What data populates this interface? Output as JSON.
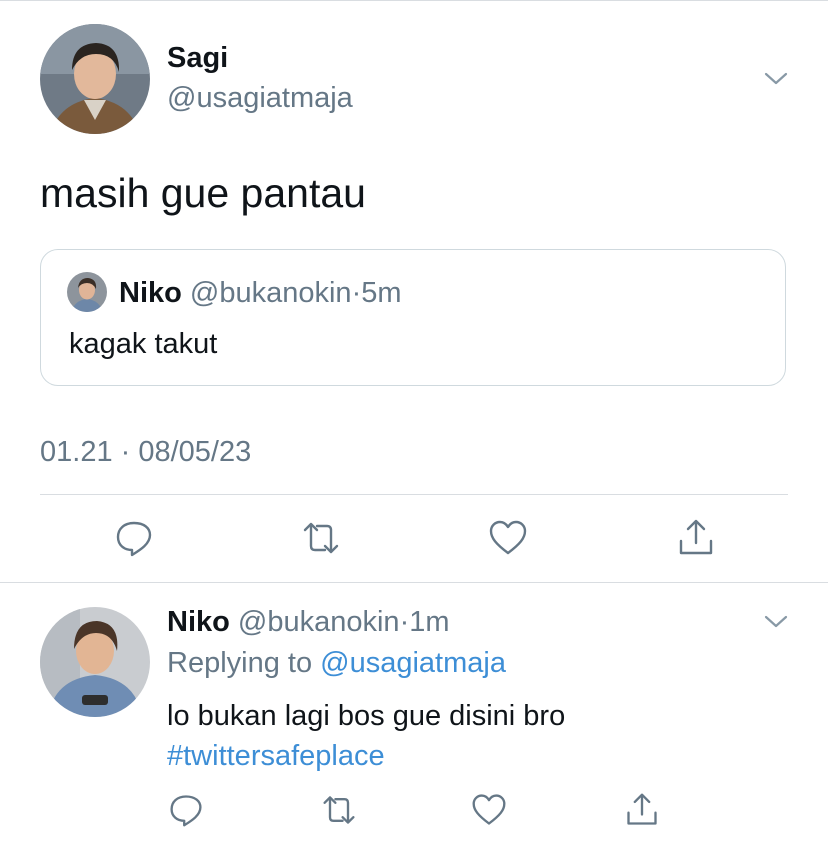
{
  "main_tweet": {
    "author_name": "Sagi",
    "author_handle": "@usagiatmaja",
    "text": "masih gue pantau",
    "timestamp": "01.21 · 08/05/23",
    "quoted": {
      "author_name": "Niko",
      "author_handle": "@bukanokin",
      "separator": "·",
      "time": "5m",
      "text": "kagak takut"
    }
  },
  "reply_tweet": {
    "author_name": "Niko",
    "author_handle": "@bukanokin",
    "separator": "·",
    "time": "1m",
    "replying_prefix": "Replying to",
    "replying_handle": "@usagiatmaja",
    "text": "lo bukan lagi bos gue disini bro",
    "hashtag": "#twittersafeplace"
  },
  "icons": {
    "reply": "reply-icon",
    "retweet": "retweet-icon",
    "like": "heart-icon",
    "share": "share-icon",
    "menu": "chevron-down-icon"
  },
  "colors": {
    "text": "#0f1419",
    "secondary": "#657786",
    "link": "#3d8ed6",
    "border": "#cfd9de"
  }
}
